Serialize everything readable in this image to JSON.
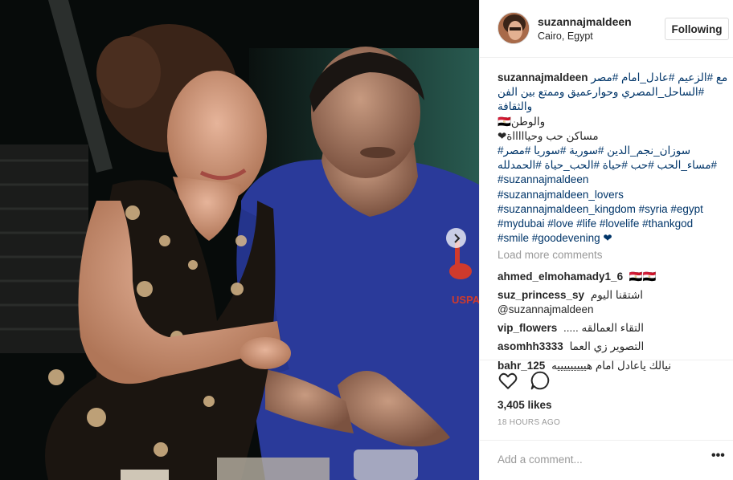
{
  "post": {
    "username": "suzannajmaldeen",
    "location": "Cairo, Egypt",
    "follow_label": "Following"
  },
  "caption": {
    "username": "suzannajmaldeen",
    "lines": [
      "مع #الزعيم #عادل_امام #مصر",
      "#الساحل_المصري وحوارعميق وممتع بين الفن والثقافة",
      "والوطن🇪🇬",
      "مساكن حب وحياااااة❤",
      "سوزان_نجم_الدين #سورية #سوريا #مصر#",
      "#مساء_الحب #حب #حياة #الحب_حياة #الحمدلله",
      "#suzannajmaldeen",
      "#suzannajmaldeen_lovers",
      "#suzannajmaldeen_kingdom #syria #egypt",
      "#mydubai #love #life #lovelife #thankgod",
      "#smile #goodevening ❤"
    ]
  },
  "load_more_label": "Load more comments",
  "comments": [
    {
      "user": "ahmed_elmohamady1_6",
      "text": "🇪🇬🇪🇬"
    },
    {
      "user": "suz_princess_sy",
      "text": "اشتقنا اليوم",
      "text2": "@suzannajmaldeen"
    },
    {
      "user": "vip_flowers",
      "text": "التقاء العمالقه ....."
    },
    {
      "user": "asomhh3333",
      "text": "التصوير زي العما"
    },
    {
      "user": "bahr_125",
      "text": "نيالك ياعادل امام هيييييييييه"
    }
  ],
  "likes": "3,405 likes",
  "time_ago": "18 HOURS AGO",
  "add_comment_placeholder": "Add a comment...",
  "more_label": "•••",
  "icons": {
    "like": "heart-icon",
    "comment": "comment-bubble-icon",
    "next": "chevron-right-icon",
    "more": "more-options-icon"
  },
  "colors": {
    "hashtag": "#003569",
    "muted": "#999999",
    "text": "#262626",
    "border": "#efefef"
  }
}
